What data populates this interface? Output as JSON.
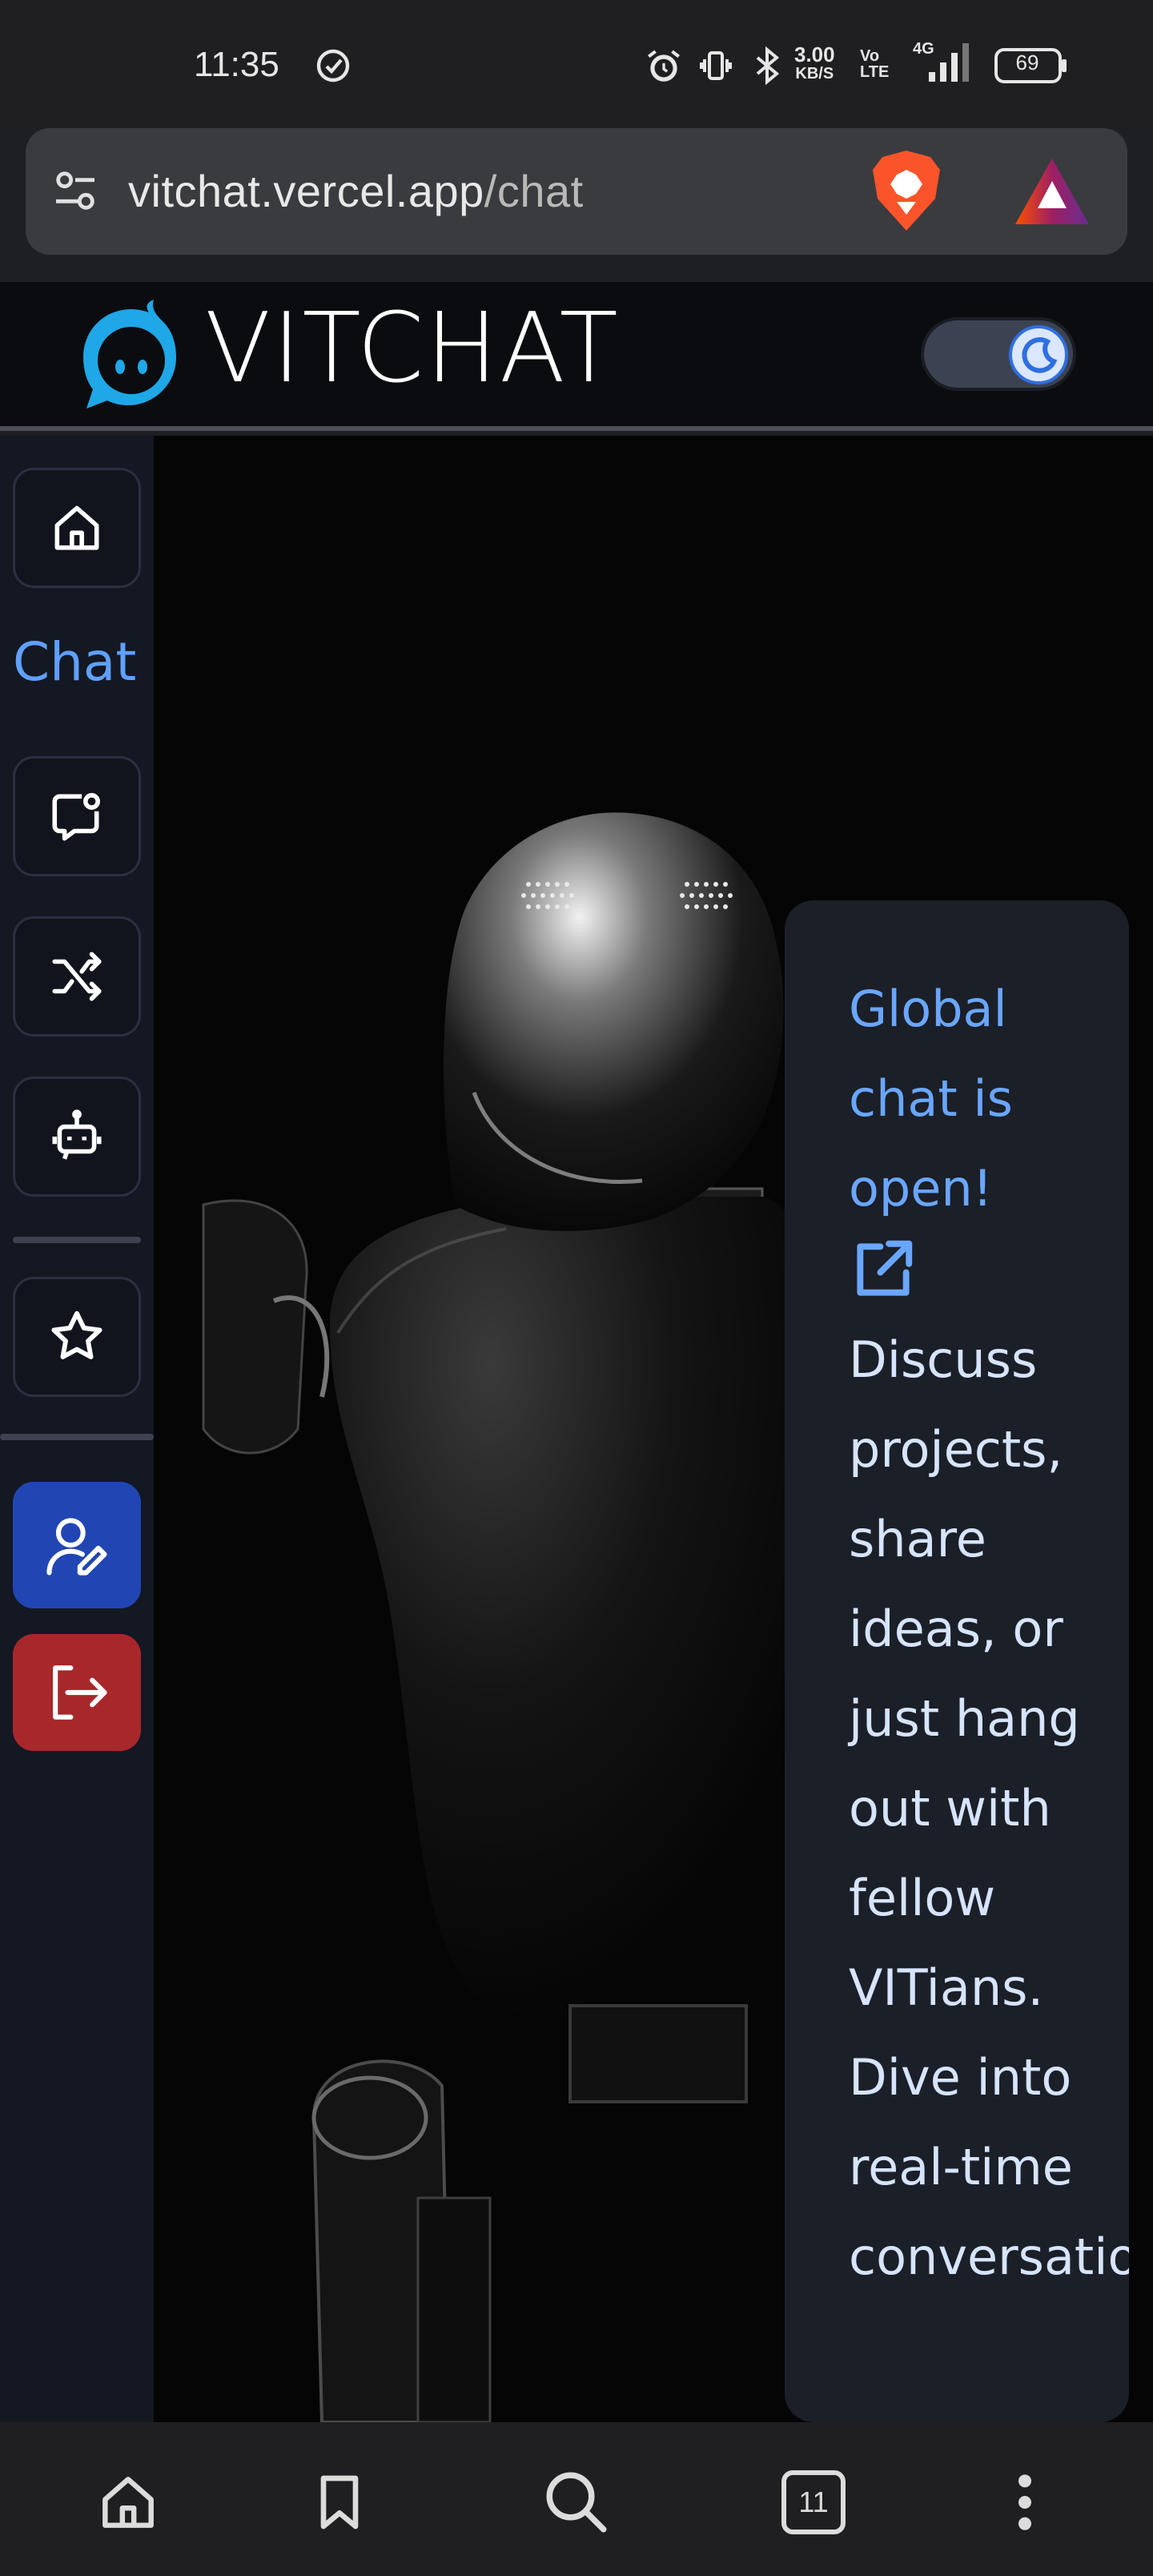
{
  "status_bar": {
    "time": "11:35",
    "net_speed_value": "3.00",
    "net_speed_unit": "KB/S",
    "network_label": "4G",
    "volte_label": "Vo LTE",
    "battery": "69",
    "icons": [
      "check-circle-icon",
      "alarm-icon",
      "vibrate-icon",
      "bluetooth-icon",
      "signal-icon",
      "battery-icon"
    ]
  },
  "browser": {
    "url_host": "vitchat.vercel.app",
    "url_path": "/chat",
    "icons": [
      "site-settings-icon",
      "brave-shield-icon",
      "brave-rewards-icon"
    ]
  },
  "header": {
    "title": "VITCHAT",
    "theme_mode": "dark"
  },
  "sidebar": {
    "section_label": "Chat",
    "items": [
      {
        "name": "home",
        "icon": "home-icon"
      },
      {
        "name": "chat",
        "icon": "chat-bubble-icon"
      },
      {
        "name": "random",
        "icon": "shuffle-icon"
      },
      {
        "name": "bot",
        "icon": "bot-icon"
      },
      {
        "name": "favorites",
        "icon": "star-icon"
      },
      {
        "name": "edit-profile",
        "icon": "user-edit-icon",
        "color": "#2146b4"
      },
      {
        "name": "logout",
        "icon": "logout-icon",
        "color": "#a8272b"
      }
    ]
  },
  "notice": {
    "title": "Global chat is open!",
    "body": "Discuss projects, share ideas, or just hang out with fellow VITians. Dive into real-time conversations",
    "title_color": "#6aa6ff",
    "body_color": "#d6e4ff"
  },
  "bottom_nav": {
    "tab_count": "11",
    "icons": [
      "home-icon",
      "bookmark-icon",
      "search-icon",
      "tabs-icon",
      "more-icon"
    ]
  }
}
